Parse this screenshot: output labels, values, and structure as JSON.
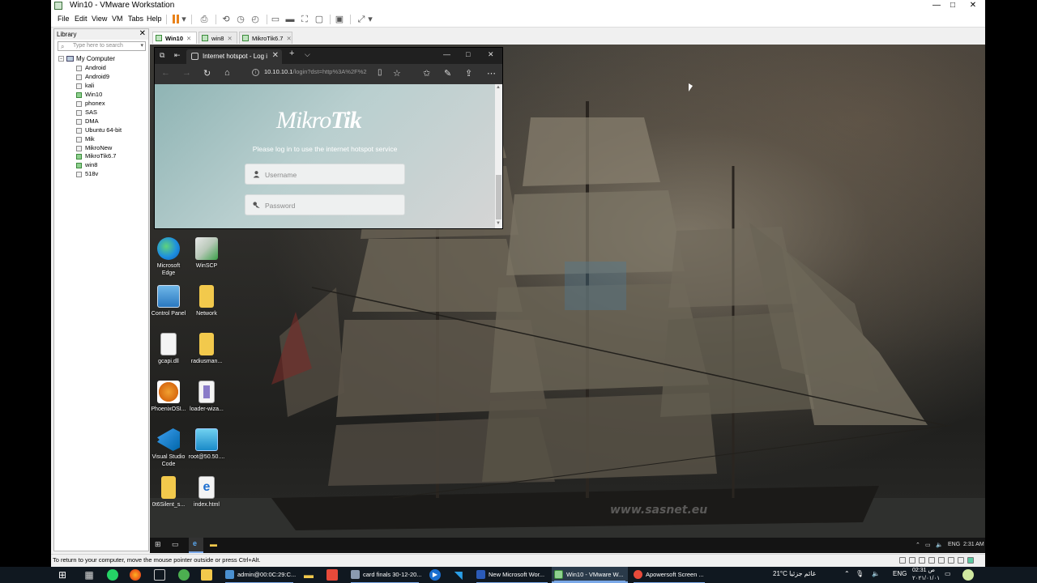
{
  "window": {
    "title": "Win10 - VMware Workstation",
    "minimize": "—",
    "maximize": "□",
    "close": "✕"
  },
  "menu": [
    "File",
    "Edit",
    "View",
    "VM",
    "Tabs",
    "Help"
  ],
  "toolbar": {
    "dropdown": "▾",
    "snap": "⟲",
    "snap2": "◷",
    "snap3": "◴",
    "view1": "▭",
    "view2": "▬",
    "view3": "⛶",
    "view4": "▢",
    "console": "▣",
    "stretch": "⤢"
  },
  "library": {
    "title": "Library",
    "close": "✕",
    "search_placeholder": "Type here to search",
    "search_icon": "⌕",
    "dropdown": "▾",
    "root_toggle": "−",
    "root": "My Computer",
    "items": [
      "Android",
      "Android9",
      "kali",
      "Win10",
      "phonex",
      "SAS",
      "DMA",
      "Ubuntu 64-bit",
      "Mik",
      "MikroNew",
      "MikroTik6.7",
      "win8",
      "518v"
    ]
  },
  "tabs": [
    {
      "label": "Win10",
      "close": "✕"
    },
    {
      "label": "win8",
      "close": "✕"
    },
    {
      "label": "MikroTik6.7",
      "close": "✕"
    }
  ],
  "browser": {
    "tab_title": "Internet hotspot - Log i",
    "tab_close": "✕",
    "new_tab": "+",
    "tab_menu": "⌵",
    "lt1": "⧉",
    "lt2": "⇤",
    "minimize": "—",
    "maximize": "□",
    "close": "✕",
    "back": "←",
    "forward": "→",
    "refresh": "↻",
    "home": "⌂",
    "url_info": "i",
    "url_host": "10.10.10.1",
    "url_path": "/login?dst=http%3A%2F%2",
    "reader": "▯",
    "favorite": "☆",
    "favorites": "✩",
    "pen": "✎",
    "share": "⇪",
    "more": "⋯",
    "scroll_up": "▲",
    "scroll_down": "▼"
  },
  "hotspot": {
    "brand_a": "Mikro",
    "brand_b": "Tik",
    "hint": "Please log in to use the internet hotspot service",
    "username_placeholder": "Username",
    "password_placeholder": "Password"
  },
  "desktop_icons": [
    {
      "label": "Microsoft Edge"
    },
    {
      "label": "WinSCP"
    },
    {
      "label": "Control Panel"
    },
    {
      "label": "Network"
    },
    {
      "label": "gcapi.dll"
    },
    {
      "label": "radiusman..."
    },
    {
      "label": "PhoenixOSI..."
    },
    {
      "label": "loader-wiza..."
    },
    {
      "label": "Visual Studio Code"
    },
    {
      "label": "root@50.50...."
    },
    {
      "label": "0t6Silent_s..."
    },
    {
      "label": "index.html"
    }
  ],
  "watermark": "www.sasnet.eu",
  "guest_taskbar": {
    "start": "⊞",
    "taskview": "▭",
    "edge": "e",
    "folder": "▬",
    "tray1": "⌃",
    "tray2": "▭",
    "tray3": "🔈",
    "lang": "ENG",
    "time": "2:31 AM"
  },
  "statusbar": {
    "message": "To return to your computer, move the mouse pointer outside or press Ctrl+Alt."
  },
  "host_taskbar": {
    "start": "⊞",
    "items": [
      {
        "label": "admin@00:0C:29:C..."
      },
      {
        "label": "card finals 30-12-20..."
      },
      {
        "label": "New Microsoft Wor..."
      },
      {
        "label": "Win10 - VMware W..."
      },
      {
        "label": "Apowersoft Screen ..."
      }
    ],
    "weather": "21°C  غائم جزئيا",
    "chevron": "⌃",
    "mic": "🎙",
    "speaker": "🔈",
    "lang": "ENG",
    "time": "02:31 ص",
    "date": "٢٠٢١/٠١/٠١",
    "notify": "▭"
  },
  "colors": {
    "vmware_accent": "#e8821a",
    "taskbar": "#101820",
    "edge_dark": "#202020"
  }
}
